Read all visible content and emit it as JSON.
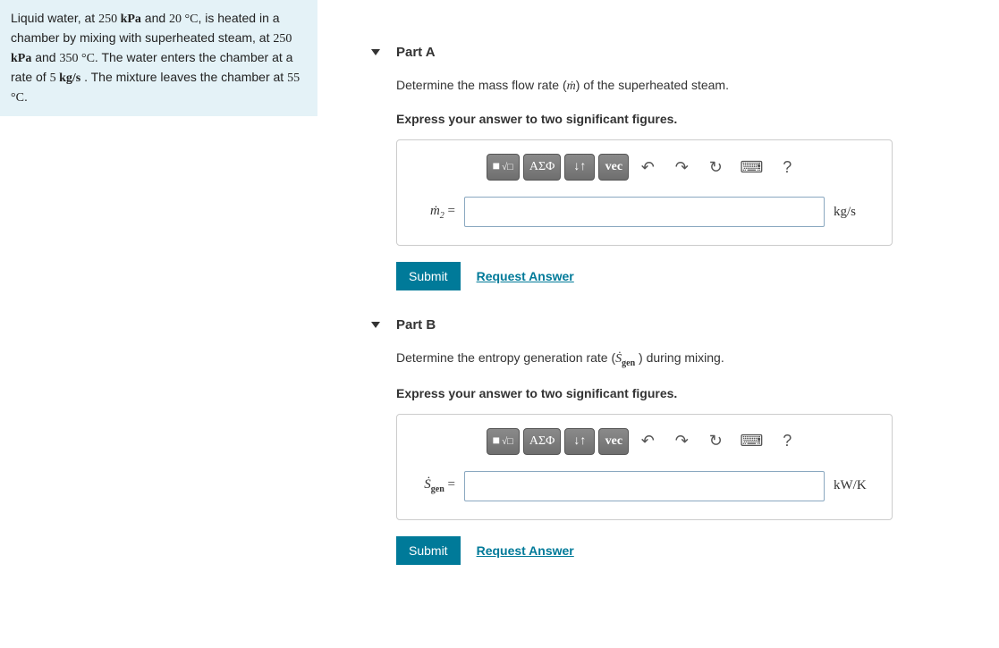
{
  "problem": {
    "text_pre": "Liquid water, at ",
    "p1": "250 ",
    "p1u": "kPa",
    "t_and": " and ",
    "t1": "20 ",
    "degC": "°C",
    "line2": ", is heated in a chamber by mixing with superheated steam, at ",
    "p2": "250 ",
    "t2": "350 ",
    "line3": ". The water enters the chamber at a rate of ",
    "rate": "5 ",
    "rateu": "kg/s",
    "line4": " . The mixture leaves the chamber at ",
    "t3": "55 ",
    "end": "."
  },
  "toolbar": {
    "templates": "■",
    "sqrt": "√□",
    "greek": "ΑΣΦ",
    "scripts": "↓↑",
    "vec": "vec",
    "undo": "↶",
    "redo": "↷",
    "reset": "↻",
    "keyboard": "⌨",
    "help": "?"
  },
  "partA": {
    "title": "Part A",
    "prompt_pre": "Determine the mass flow rate (",
    "var": "ṁ",
    "prompt_post": ") of the superheated steam.",
    "express": "Express your answer to two significant figures.",
    "label_var": "ṁ",
    "label_sub": "2",
    "eq": " = ",
    "unit": "kg/s"
  },
  "partB": {
    "title": "Part B",
    "prompt_pre": "Determine the entropy generation rate (",
    "var": "Ṡ",
    "var_sub": "gen",
    "prompt_post": " ) during mixing.",
    "express": "Express your answer to two significant figures.",
    "label_var": "Ṡ",
    "label_sub": "gen",
    "eq": " = ",
    "unit": "kW/K"
  },
  "buttons": {
    "submit": "Submit",
    "request": "Request Answer"
  }
}
